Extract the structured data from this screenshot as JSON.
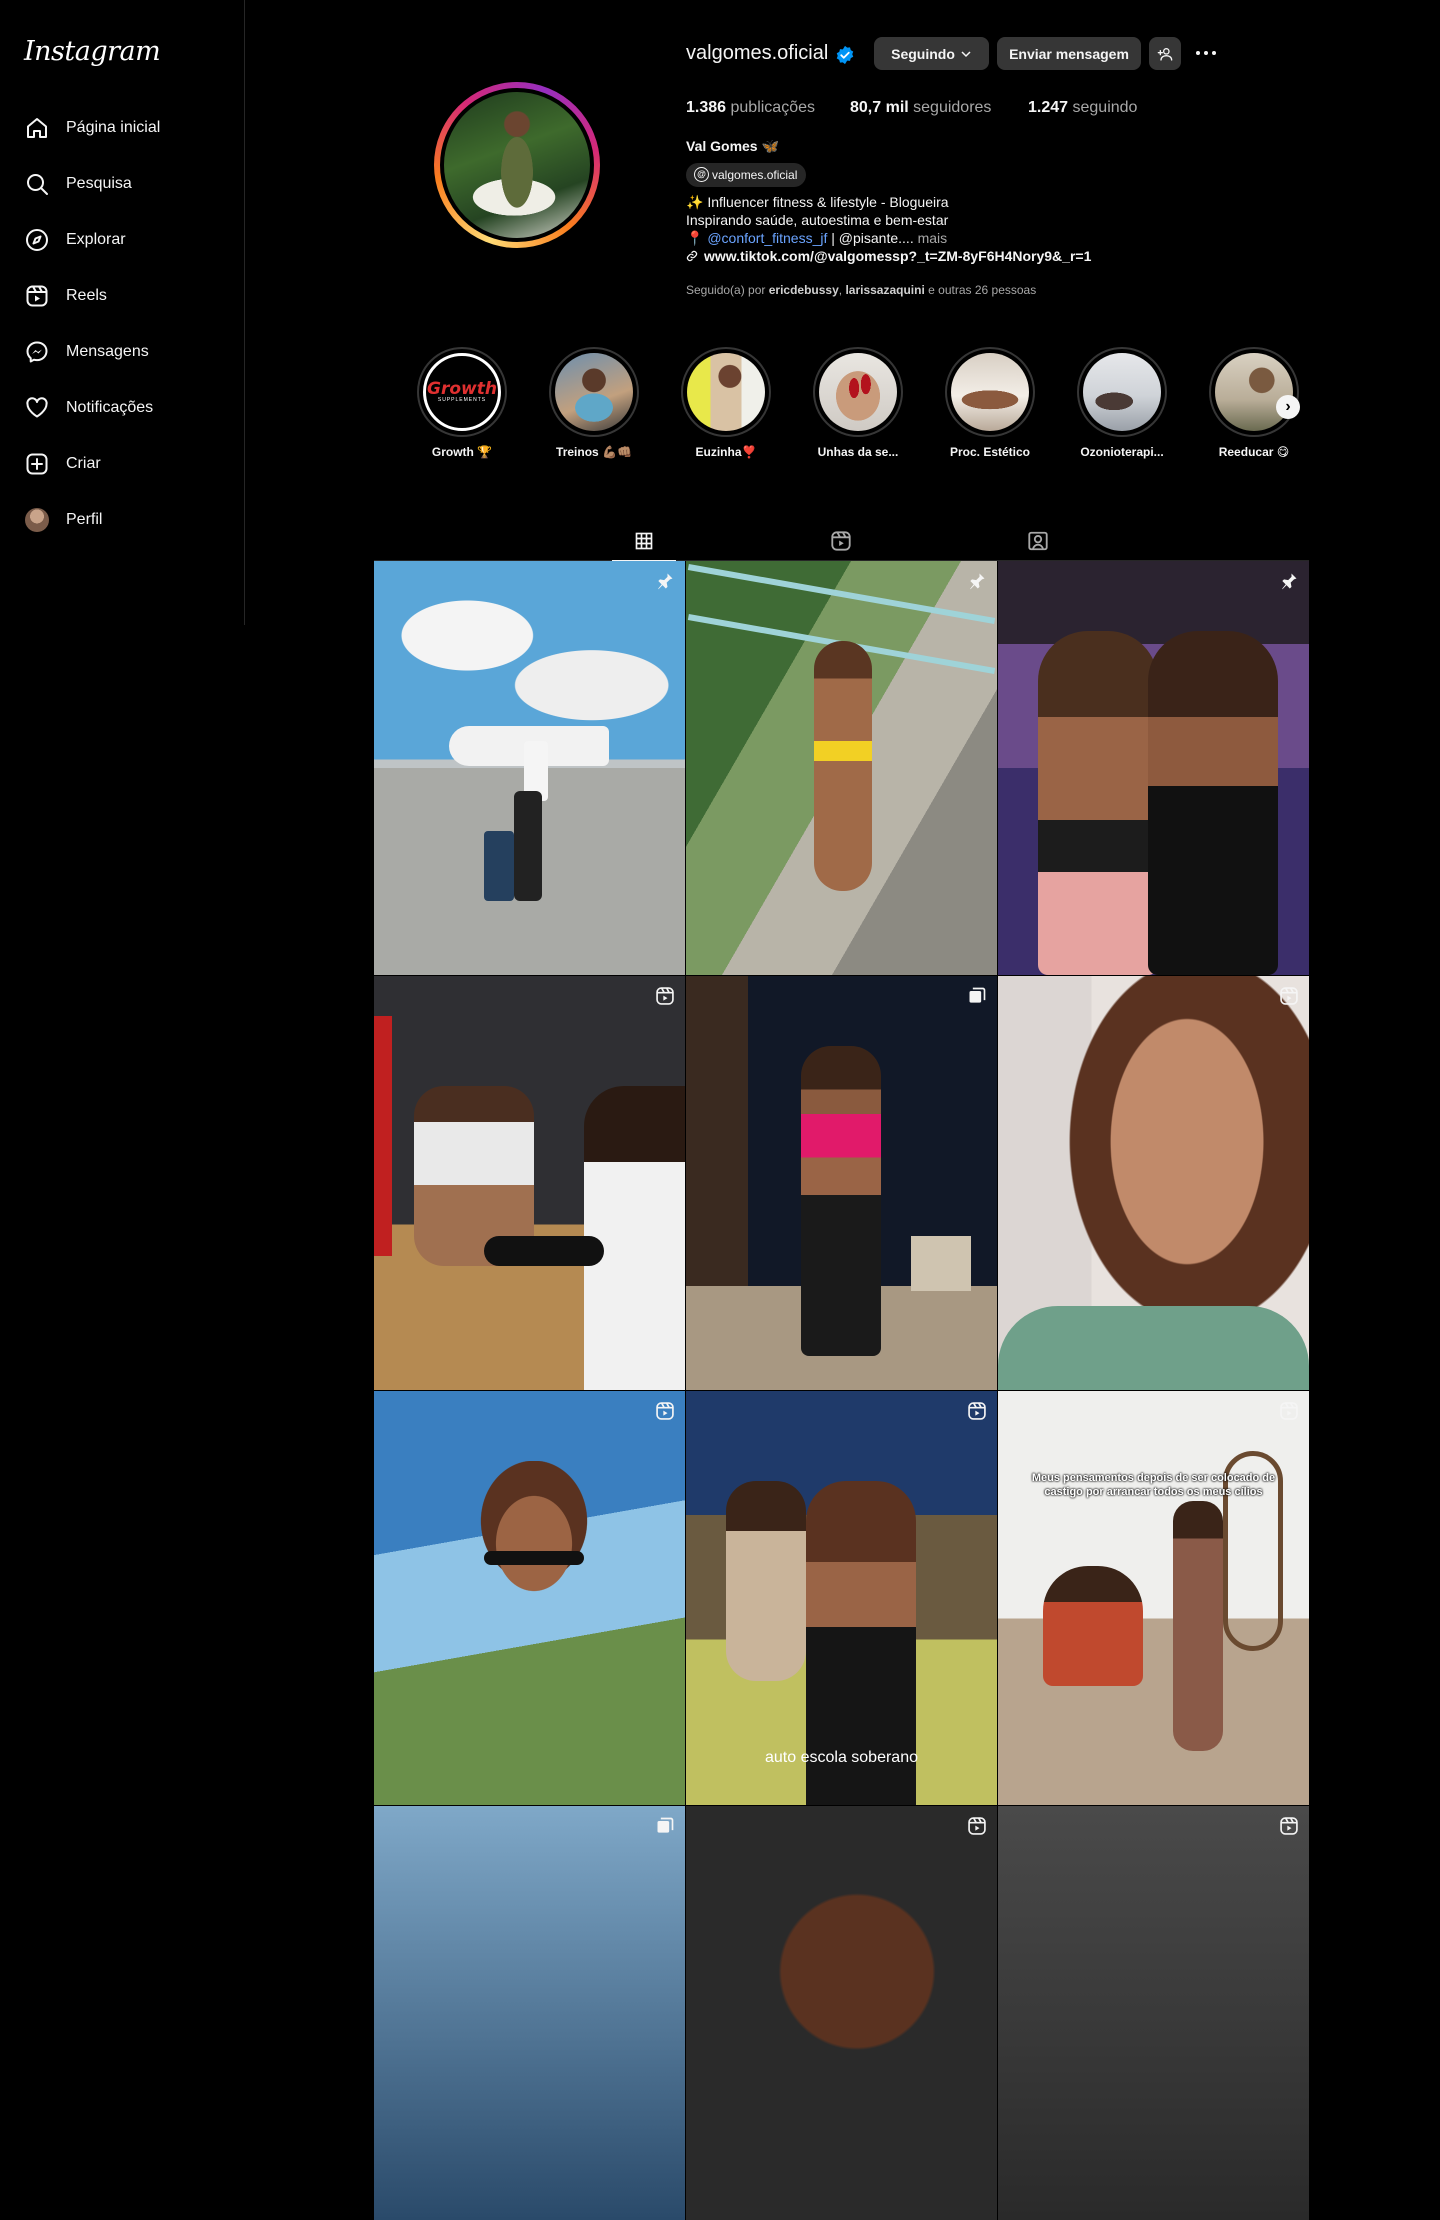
{
  "sidebar": {
    "logo": "Instagram",
    "items": [
      {
        "label": "Página inicial",
        "icon": "home-icon"
      },
      {
        "label": "Pesquisa",
        "icon": "search-icon"
      },
      {
        "label": "Explorar",
        "icon": "compass-icon"
      },
      {
        "label": "Reels",
        "icon": "reels-icon"
      },
      {
        "label": "Mensagens",
        "icon": "messenger-icon"
      },
      {
        "label": "Notificações",
        "icon": "heart-icon"
      },
      {
        "label": "Criar",
        "icon": "plus-square-icon"
      },
      {
        "label": "Perfil",
        "icon": "avatar"
      }
    ]
  },
  "profile": {
    "username": "valgomes.oficial",
    "verified": true,
    "buttons": {
      "following": "Seguindo",
      "message": "Enviar mensagem"
    },
    "stats": {
      "posts_value": "1.386",
      "posts_label": "publicações",
      "followers_value": "80,7 mil",
      "followers_label": "seguidores",
      "following_value": "1.247",
      "following_label": "seguindo"
    },
    "full_name": "Val Gomes 🦋",
    "threads_handle": "valgomes.oficial",
    "bio_line1": "✨ Influencer fitness & lifestyle - Blogueira",
    "bio_line2": "Inspirando saúde, autoestima e bem-estar",
    "bio_line3_pin": "📍",
    "bio_line3_mention": "@confort_fitness_jf",
    "bio_line3_rest": " | @pisante....",
    "bio_more": "mais",
    "link": "www.tiktok.com/@valgomessp?_t=ZM-8yF6H4Nory9&_r=1",
    "followed_prefix": "Seguido(a) por ",
    "followed_user1": "ericdebussy",
    "followed_sep": ", ",
    "followed_user2": "larissazaquini",
    "followed_suffix": " e outras 26 pessoas"
  },
  "highlights": [
    {
      "label": "Growth 🏆"
    },
    {
      "label": "Treinos 💪🏽👊🏽"
    },
    {
      "label": "Euzinha❣️"
    },
    {
      "label": "Unhas da se..."
    },
    {
      "label": "Proc. Estético"
    },
    {
      "label": "Ozonioterapi..."
    },
    {
      "label": "Reeducar 😋"
    }
  ],
  "highlight_growth_logo": "Growth",
  "highlight_growth_sub": "SUPPLEMENTS",
  "tabs": [
    {
      "name": "posts",
      "icon": "grid-icon",
      "active": true
    },
    {
      "name": "reels",
      "icon": "reels-icon",
      "active": false
    },
    {
      "name": "tagged",
      "icon": "tagged-icon",
      "active": false
    }
  ],
  "posts": [
    {
      "type": "pinned"
    },
    {
      "type": "pinned"
    },
    {
      "type": "pinned"
    },
    {
      "type": "reel"
    },
    {
      "type": "carousel"
    },
    {
      "type": "reel"
    },
    {
      "type": "reel"
    },
    {
      "type": "reel",
      "overlay_text": "auto escola soberano"
    },
    {
      "type": "reel",
      "overlay_text": "Meus pensamentos depois de ser colocado de castigo por arrancar todos os meus cílios"
    },
    {
      "type": "carousel"
    },
    {
      "type": "reel"
    },
    {
      "type": "reel"
    }
  ],
  "colors": {
    "background": "#000000",
    "accent_link": "#6ba4ff",
    "verified": "#0095f6",
    "button": "#363636"
  }
}
